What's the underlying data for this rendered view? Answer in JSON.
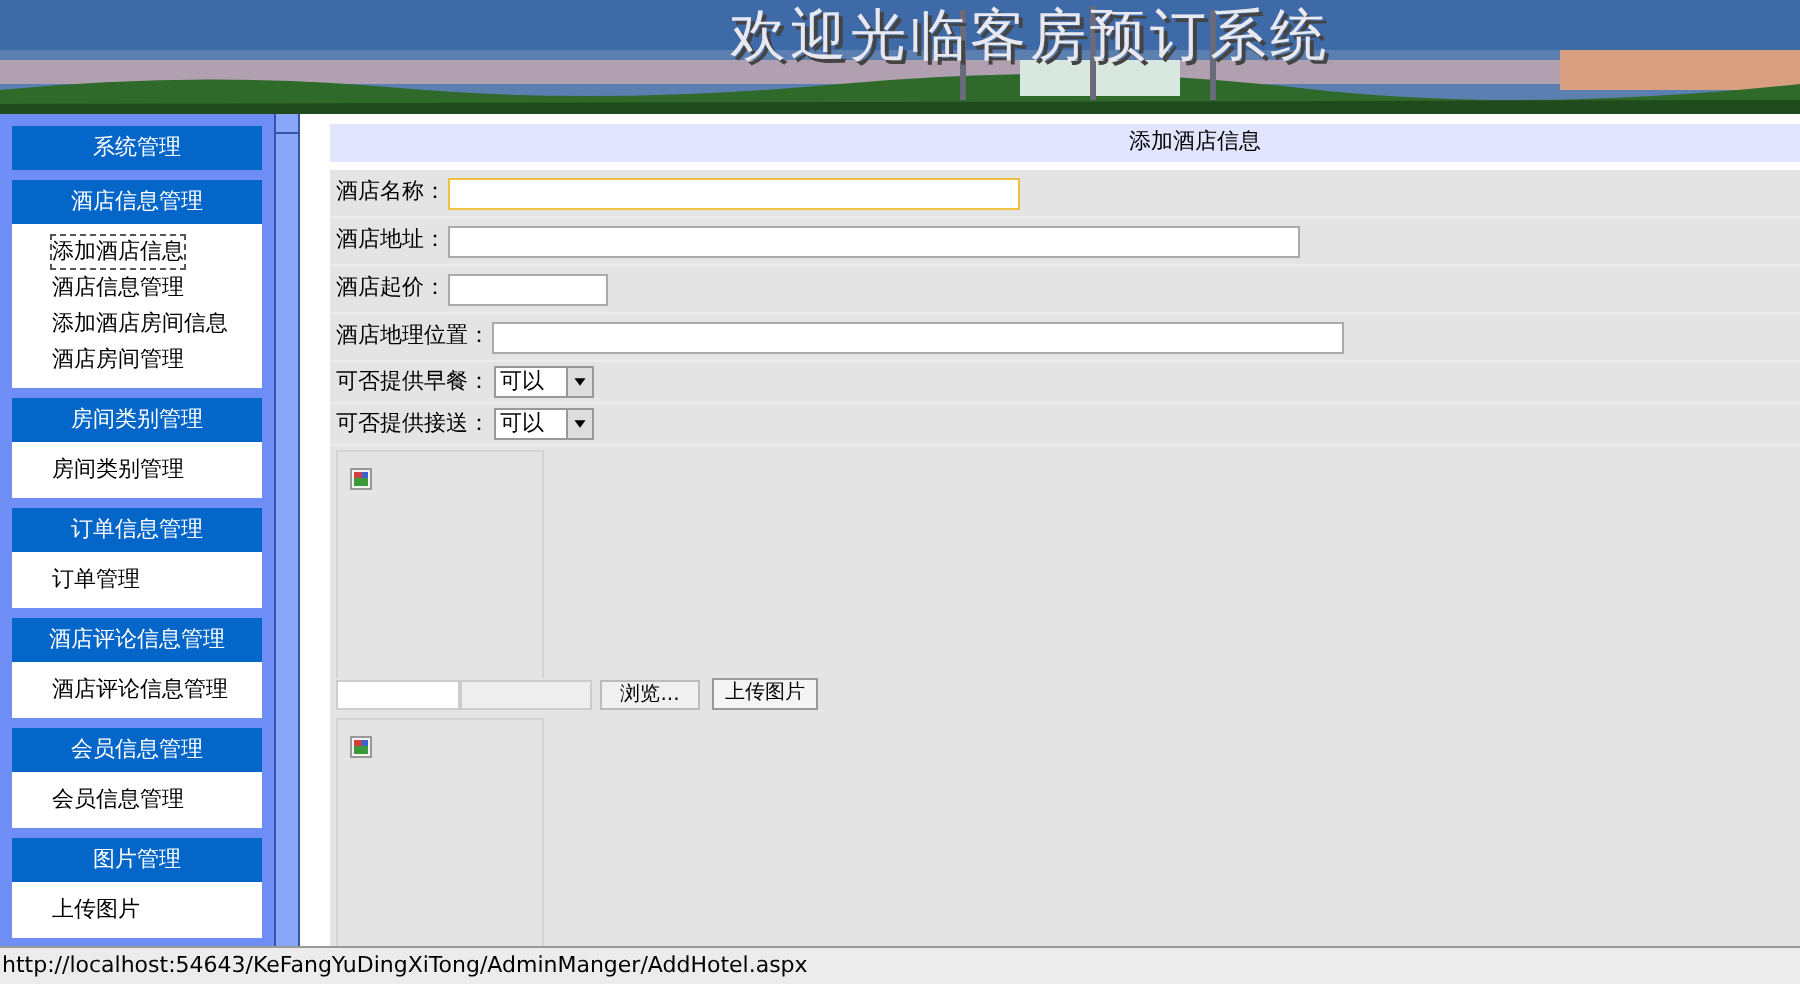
{
  "banner": {
    "title": "欢迎光临客房预订系统"
  },
  "sidebar": {
    "groups": [
      {
        "title": "系统管理"
      },
      {
        "title": "酒店信息管理",
        "items": [
          {
            "label": "添加酒店信息",
            "selected": true
          },
          {
            "label": "酒店信息管理",
            "selected": false
          },
          {
            "label": "添加酒店房间信息",
            "selected": false
          },
          {
            "label": "酒店房间管理",
            "selected": false
          }
        ]
      },
      {
        "title": "房间类别管理",
        "items": [
          {
            "label": "房间类别管理",
            "selected": false
          }
        ]
      },
      {
        "title": "订单信息管理",
        "items": [
          {
            "label": "订单管理",
            "selected": false
          }
        ]
      },
      {
        "title": "酒店评论信息管理",
        "items": [
          {
            "label": "酒店评论信息管理",
            "selected": false
          }
        ]
      },
      {
        "title": "会员信息管理",
        "items": [
          {
            "label": "会员信息管理",
            "selected": false
          }
        ]
      },
      {
        "title": "图片管理",
        "items": [
          {
            "label": "上传图片",
            "selected": false
          }
        ]
      }
    ]
  },
  "form": {
    "title": "添加酒店信息",
    "fields": [
      {
        "kind": "text",
        "label": "酒店名称：",
        "focused": true
      },
      {
        "kind": "text",
        "label": "酒店地址：",
        "focused": false
      },
      {
        "kind": "text",
        "label": "酒店起价：",
        "focused": false
      },
      {
        "kind": "text",
        "label": "酒店地理位置：",
        "focused": false
      },
      {
        "kind": "select",
        "label": "可否提供早餐：",
        "value": "可以"
      },
      {
        "kind": "select",
        "label": "可否提供接送：",
        "value": "可以"
      }
    ],
    "browse_button": "浏览...",
    "upload_button": "上传图片"
  },
  "status_bar": {
    "url": "http://localhost:54643/KeFangYuDingXiTong/AdminManger/AddHotel.aspx"
  }
}
